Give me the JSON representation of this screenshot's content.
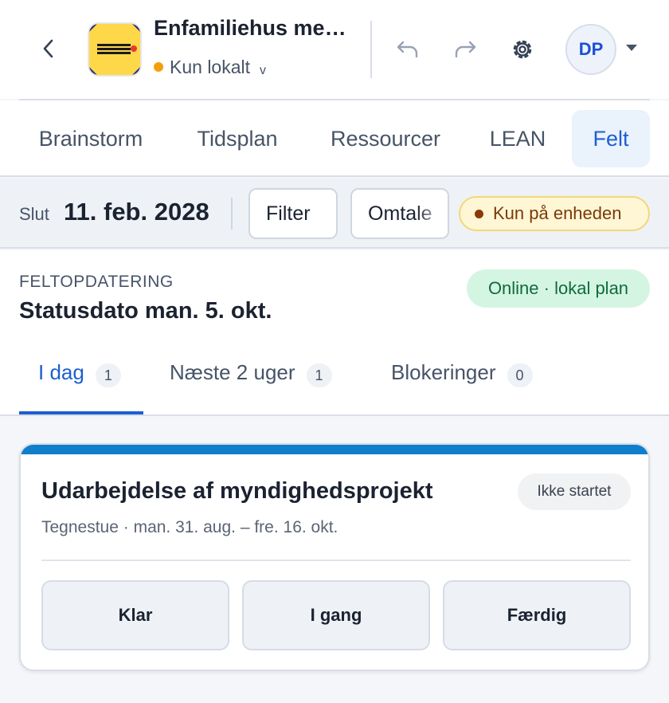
{
  "header": {
    "app_title": "Enfamiliehus me…",
    "status_label": "Kun lokalt",
    "status_caret": "v",
    "status_color": "#f59e0b",
    "avatar_initials": "DP",
    "icons": [
      "back-icon",
      "undo-icon",
      "redo-icon",
      "settings-icon",
      "chevron-down-icon"
    ]
  },
  "nav": {
    "tabs": [
      {
        "label": "Brainstorm"
      },
      {
        "label": "Tidsplan"
      },
      {
        "label": "Ressourcer"
      },
      {
        "label": "LEAN"
      },
      {
        "label": "Felt"
      }
    ],
    "active": "Felt"
  },
  "filterbar": {
    "slut_label": "Slut",
    "slut_date": "11. feb. 2028",
    "filter_label": "Filter",
    "omtale_label": "Omtale",
    "device_badge": "Kun på enheden"
  },
  "field": {
    "eyebrow": "FELTOPDATERING",
    "title": "Statusdato man. 5. okt.",
    "online_badge": "Online · lokal plan",
    "subtabs": [
      {
        "label": "I dag",
        "count": "1"
      },
      {
        "label": "Næste 2 uger",
        "count": "1"
      },
      {
        "label": "Blokeringer",
        "count": "0"
      }
    ],
    "active_subtab": "I dag"
  },
  "card": {
    "title": "Udarbejdelse af myndighedsprojekt",
    "subtitle": "Tegnestue · man. 31. aug. – fre. 16. okt.",
    "status_badge": "Ikke startet",
    "accent_color": "#0f7ecb",
    "actions": [
      {
        "label": "Klar"
      },
      {
        "label": "I gang"
      },
      {
        "label": "Færdig"
      }
    ]
  }
}
